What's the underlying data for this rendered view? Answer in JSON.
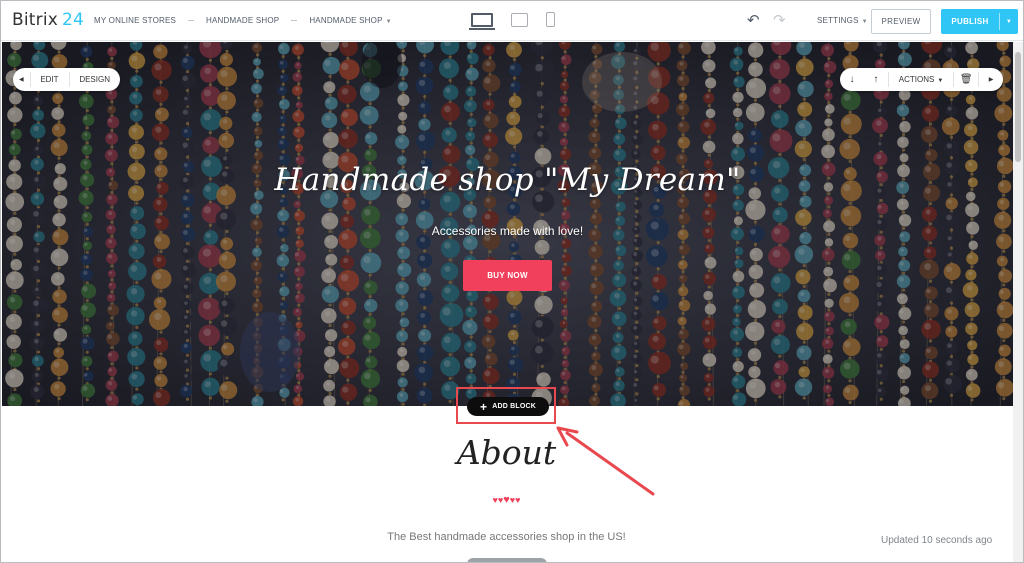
{
  "topbar": {
    "logo_name": "Bitrix",
    "logo_num": "24",
    "breadcrumbs": [
      "MY ONLINE STORES",
      "HANDMADE SHOP",
      "HANDMADE SHOP"
    ],
    "settings_label": "SETTINGS",
    "preview_label": "PREVIEW",
    "publish_label": "PUBLISH"
  },
  "hero": {
    "title": "Handmade shop \"My Dream\"",
    "subtitle": "Accessories made with love!",
    "button_label": "BUY NOW",
    "edit_label": "EDIT",
    "design_label": "DESIGN",
    "actions_label": "ACTIONS"
  },
  "add_block_label": "ADD BLOCK",
  "about": {
    "title": "About",
    "text": "The Best handmade accessories shop in the US!",
    "updated": "Updated 10 seconds ago"
  },
  "colors": {
    "accent": "#2fc6f6",
    "button": "#f0405b",
    "highlight": "#e8494f"
  }
}
